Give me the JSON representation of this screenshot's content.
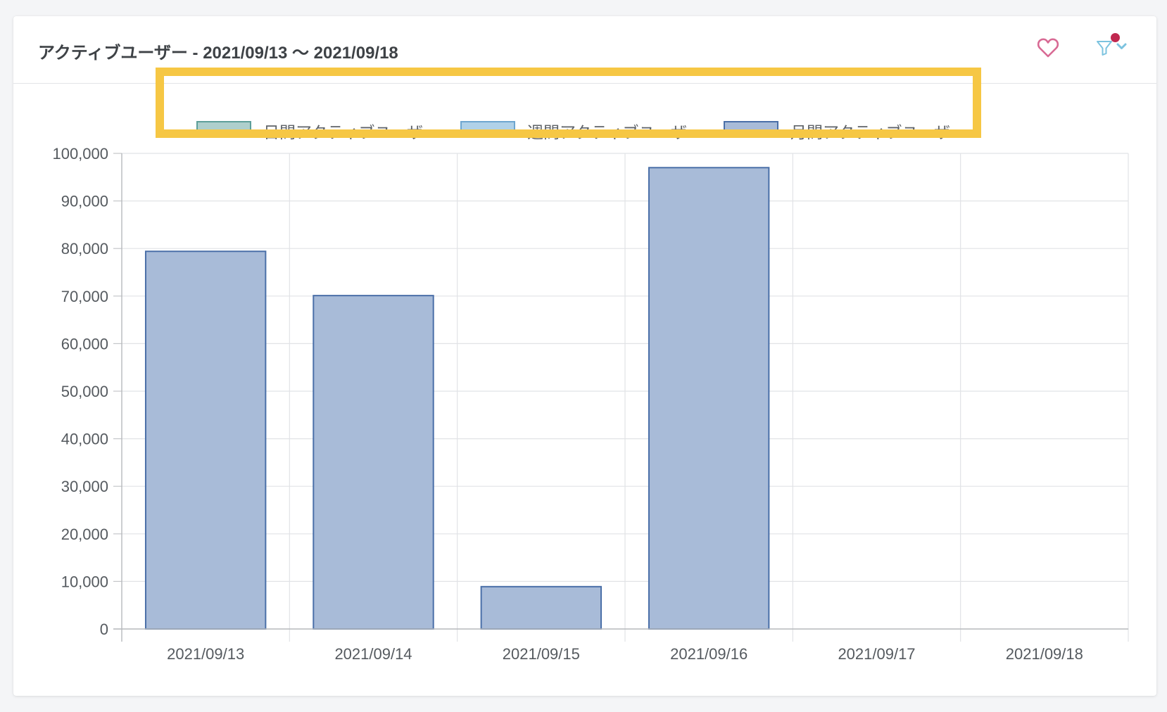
{
  "header": {
    "title": "アクティブユーザー - 2021/09/13 〜 2021/09/18"
  },
  "icons": {
    "favorite": "heart-outline-icon",
    "filter": "filter-funnel-icon",
    "filter_badge_color": "#c0284f",
    "heart_color": "#d86a94",
    "filter_color": "#7cc3df"
  },
  "highlight_color": "#f6c744",
  "legend": {
    "items": [
      {
        "label": "日間アクティブユーザー",
        "hidden": true,
        "fill": "#aecfcc",
        "stroke": "#5d9f99"
      },
      {
        "label": "週間アクティブユーザー",
        "hidden": true,
        "fill": "#b0d1e8",
        "stroke": "#6ea6cf"
      },
      {
        "label": "月間アクティブユーザー",
        "hidden": false,
        "fill": "#a8bbd8",
        "stroke": "#4a6fa8"
      }
    ]
  },
  "chart_data": {
    "type": "bar",
    "categories": [
      "2021/09/13",
      "2021/09/14",
      "2021/09/15",
      "2021/09/16",
      "2021/09/17",
      "2021/09/18"
    ],
    "series": [
      {
        "name": "日間アクティブユーザー",
        "values": [
          null,
          null,
          null,
          null,
          null,
          null
        ],
        "hidden": true
      },
      {
        "name": "週間アクティブユーザー",
        "values": [
          null,
          null,
          null,
          null,
          null,
          null
        ],
        "hidden": true
      },
      {
        "name": "月間アクティブユーザー",
        "values": [
          79400,
          70100,
          8900,
          97000,
          0,
          0
        ],
        "hidden": false
      }
    ],
    "yticks": [
      "0",
      "10,000",
      "20,000",
      "30,000",
      "40,000",
      "50,000",
      "60,000",
      "70,000",
      "80,000",
      "90,000",
      "100,000"
    ],
    "ylim": [
      0,
      100000
    ],
    "grid": true,
    "legend_position": "top"
  }
}
